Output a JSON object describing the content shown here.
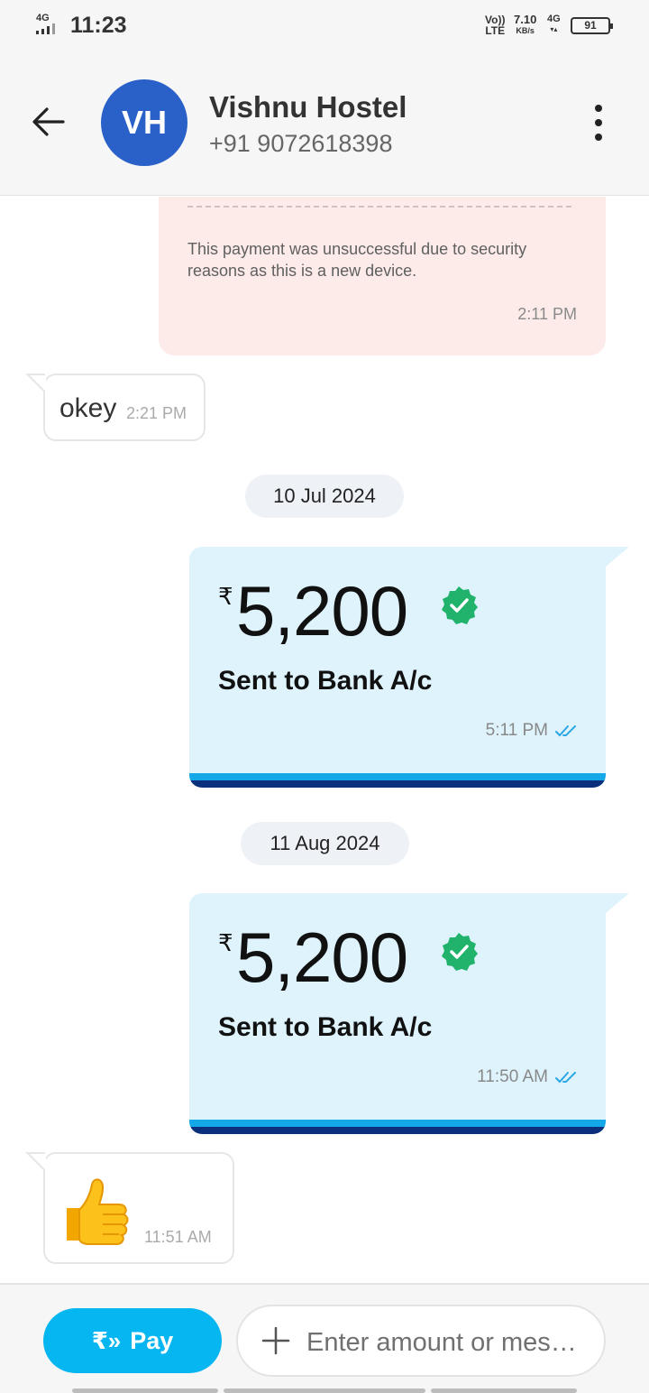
{
  "status_bar": {
    "network": "4G",
    "time": "11:23",
    "volte_top": "Vo))",
    "volte_bottom": "LTE",
    "speed": "7.10",
    "speed_unit": "KB/s",
    "data_network": "4G",
    "battery": "91"
  },
  "header": {
    "avatar_initials": "VH",
    "avatar_color": "#2a61c9",
    "contact_name": "Vishnu Hostel",
    "contact_phone": "+91 9072618398"
  },
  "messages": {
    "failed_payment": {
      "text": "This payment was unsuccessful due to security reasons as this is a new device.",
      "time": "2:11 PM"
    },
    "okey": {
      "text": "okey",
      "time": "2:21 PM"
    },
    "date_1": "10 Jul 2024",
    "payment_1": {
      "currency": "₹",
      "amount": "5,200",
      "label": "Sent to Bank A/c",
      "time": "5:11 PM"
    },
    "date_2": "11 Aug 2024",
    "payment_2": {
      "currency": "₹",
      "amount": "5,200",
      "label": "Sent to Bank A/c",
      "time": "11:50 AM"
    },
    "thumbs_up": {
      "emoji": "thumbs-up",
      "time": "11:51 AM"
    }
  },
  "composer": {
    "pay_label": "Pay",
    "pay_icon": "₹»",
    "placeholder": "Enter amount or mes…"
  },
  "colors": {
    "pay_accent": "#06b6f0",
    "card_bg": "#dff3fc",
    "verified_green": "#21b36b",
    "failed_bg": "#fdebea"
  }
}
